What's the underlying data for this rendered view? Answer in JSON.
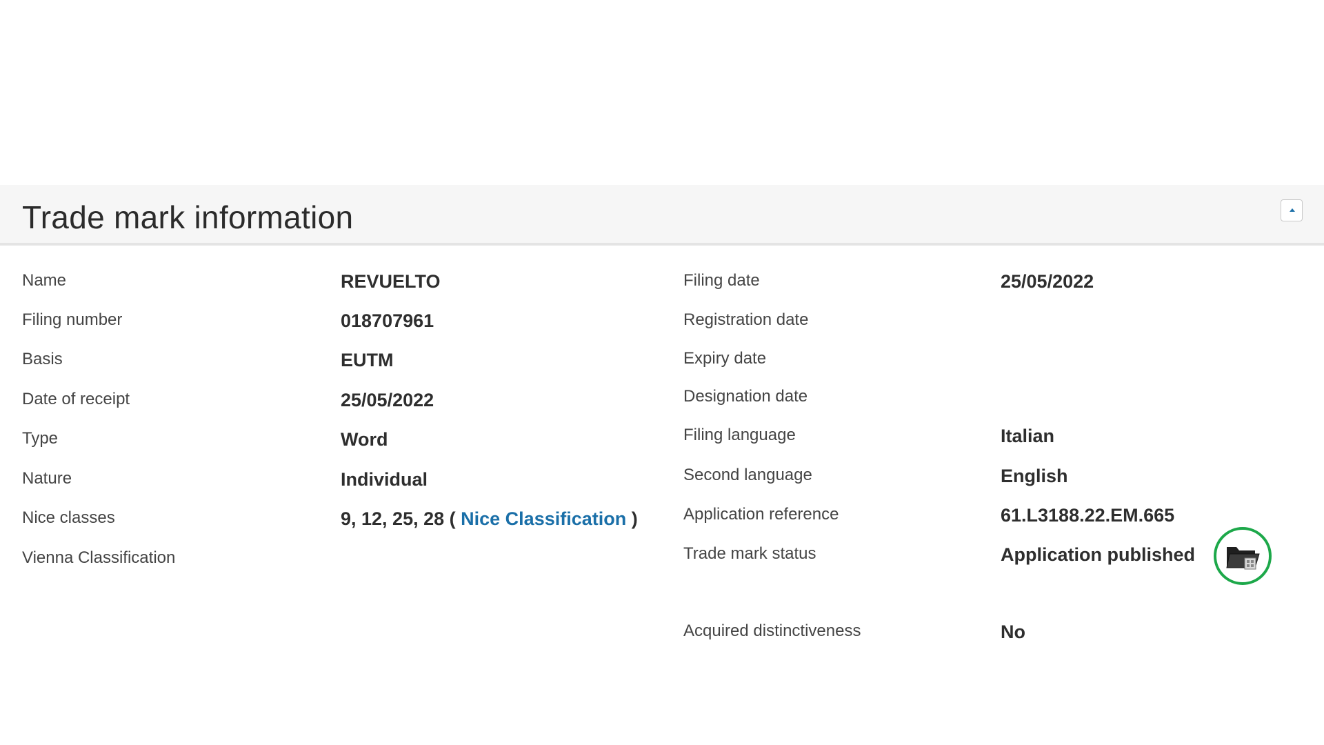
{
  "section": {
    "title": "Trade mark information",
    "collapse_icon": "caret-up-icon"
  },
  "left_fields": [
    {
      "label": "Name",
      "value": "REVUELTO"
    },
    {
      "label": "Filing number",
      "value": "018707961"
    },
    {
      "label": "Basis",
      "value": "EUTM"
    },
    {
      "label": "Date of receipt",
      "value": "25/05/2022"
    },
    {
      "label": "Type",
      "value": "Word"
    },
    {
      "label": "Nature",
      "value": "Individual"
    },
    {
      "label": "Nice classes",
      "value": "9, 12, 25, 28 (",
      "link": "Nice Classification",
      "suffix": ")"
    },
    {
      "label": "Vienna Classification",
      "value": ""
    }
  ],
  "right_fields": [
    {
      "label": "Filing date",
      "value": "25/05/2022"
    },
    {
      "label": "Registration date",
      "value": ""
    },
    {
      "label": "Expiry date",
      "value": ""
    },
    {
      "label": "Designation date",
      "value": ""
    },
    {
      "label": "Filing language",
      "value": "Italian"
    },
    {
      "label": "Second language",
      "value": "English"
    },
    {
      "label": "Application reference",
      "value": "61.L3188.22.EM.665"
    },
    {
      "label": "Trade mark status",
      "value": "Application published",
      "icon": "folder-status-icon"
    },
    {
      "label": "Acquired distinctiveness",
      "value": "No"
    }
  ],
  "colors": {
    "link": "#1a6fa8",
    "status_ring": "#1da84a",
    "header_bg": "#f6f6f6"
  }
}
